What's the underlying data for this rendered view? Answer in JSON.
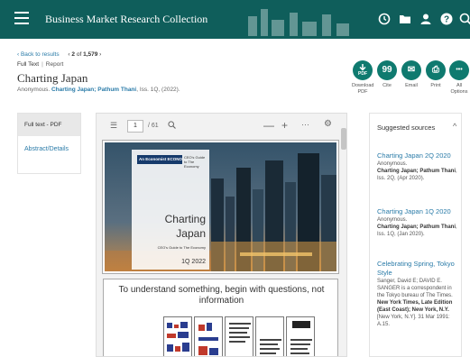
{
  "header": {
    "brand": "Business Market Research Collection",
    "icons": [
      "history-icon",
      "folder-icon",
      "user-icon",
      "help-icon",
      "search-icon"
    ]
  },
  "nav": {
    "back_label": "‹ Back to results",
    "position_current": "2",
    "position_total": "1,579",
    "position_prefix": "‹",
    "position_of": "of",
    "position_suffix": "›"
  },
  "doc": {
    "format": "Full Text",
    "type": "Report",
    "title": "Charting Japan",
    "author": "Anonymous.",
    "publication": "Charting Japan; Pathum Thani",
    "issue": "Iss. 1Q, (2022)."
  },
  "actions": [
    {
      "label": "Download PDF",
      "glyph": "PDF",
      "icon": "download-pdf-icon"
    },
    {
      "label": "Cite",
      "glyph": "99",
      "icon": "cite-icon"
    },
    {
      "label": "Email",
      "glyph": "✉",
      "icon": "email-icon"
    },
    {
      "label": "Print",
      "glyph": "⎙",
      "icon": "print-icon"
    },
    {
      "label": "All Options",
      "glyph": "•••",
      "icon": "more-icon"
    }
  ],
  "side_tabs": {
    "active": "Full text - PDF",
    "other": "Abstract/Details"
  },
  "viewer": {
    "page": "1",
    "total": "/ 61",
    "minus": "—",
    "plus": "+",
    "more": "···",
    "cover": {
      "logo_text": "An Economist ECONOMY",
      "tag_text": "CEO's Guide to The Economy",
      "title_line1": "Charting",
      "title_line2": "Japan",
      "subtitle": "CEO's Guide to The Economy",
      "date": "1Q 2022"
    },
    "page2_heading": "To understand something, begin with questions, not information"
  },
  "suggested": {
    "header": "Suggested sources",
    "items": [
      {
        "title": "Charting Japan 2Q 2020",
        "author": "Anonymous.",
        "source": "Charting Japan; Pathum Thani",
        "issue": "Iss. 2Q, (Apr 2020)."
      },
      {
        "title": "Charting Japan 1Q 2020",
        "author": "Anonymous.",
        "source": "Charting Japan; Pathum Thani",
        "issue": "Iss. 1Q, (Jan 2020)."
      },
      {
        "title": "Celebrating Spring, Tokyo Style",
        "author": "Sanger, David E; DAVID E. SANGER is a correspondent in the Tokyo bureau of The Times.",
        "source": "New York Times, Late Edition (East Coast); New York, N.Y.",
        "issue": "[New York, N.Y]. 31 Mar 1991: A.15."
      }
    ]
  }
}
